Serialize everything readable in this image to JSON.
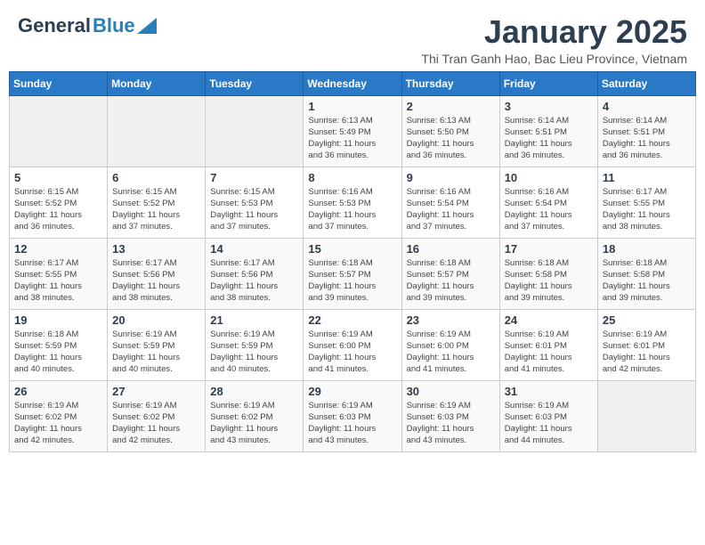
{
  "header": {
    "logo_general": "General",
    "logo_blue": "Blue",
    "calendar_title": "January 2025",
    "calendar_subtitle": "Thi Tran Ganh Hao, Bac Lieu Province, Vietnam"
  },
  "days_of_week": [
    "Sunday",
    "Monday",
    "Tuesday",
    "Wednesday",
    "Thursday",
    "Friday",
    "Saturday"
  ],
  "weeks": [
    [
      {
        "day": "",
        "info": ""
      },
      {
        "day": "",
        "info": ""
      },
      {
        "day": "",
        "info": ""
      },
      {
        "day": "1",
        "info": "Sunrise: 6:13 AM\nSunset: 5:49 PM\nDaylight: 11 hours\nand 36 minutes."
      },
      {
        "day": "2",
        "info": "Sunrise: 6:13 AM\nSunset: 5:50 PM\nDaylight: 11 hours\nand 36 minutes."
      },
      {
        "day": "3",
        "info": "Sunrise: 6:14 AM\nSunset: 5:51 PM\nDaylight: 11 hours\nand 36 minutes."
      },
      {
        "day": "4",
        "info": "Sunrise: 6:14 AM\nSunset: 5:51 PM\nDaylight: 11 hours\nand 36 minutes."
      }
    ],
    [
      {
        "day": "5",
        "info": "Sunrise: 6:15 AM\nSunset: 5:52 PM\nDaylight: 11 hours\nand 36 minutes."
      },
      {
        "day": "6",
        "info": "Sunrise: 6:15 AM\nSunset: 5:52 PM\nDaylight: 11 hours\nand 37 minutes."
      },
      {
        "day": "7",
        "info": "Sunrise: 6:15 AM\nSunset: 5:53 PM\nDaylight: 11 hours\nand 37 minutes."
      },
      {
        "day": "8",
        "info": "Sunrise: 6:16 AM\nSunset: 5:53 PM\nDaylight: 11 hours\nand 37 minutes."
      },
      {
        "day": "9",
        "info": "Sunrise: 6:16 AM\nSunset: 5:54 PM\nDaylight: 11 hours\nand 37 minutes."
      },
      {
        "day": "10",
        "info": "Sunrise: 6:16 AM\nSunset: 5:54 PM\nDaylight: 11 hours\nand 37 minutes."
      },
      {
        "day": "11",
        "info": "Sunrise: 6:17 AM\nSunset: 5:55 PM\nDaylight: 11 hours\nand 38 minutes."
      }
    ],
    [
      {
        "day": "12",
        "info": "Sunrise: 6:17 AM\nSunset: 5:55 PM\nDaylight: 11 hours\nand 38 minutes."
      },
      {
        "day": "13",
        "info": "Sunrise: 6:17 AM\nSunset: 5:56 PM\nDaylight: 11 hours\nand 38 minutes."
      },
      {
        "day": "14",
        "info": "Sunrise: 6:17 AM\nSunset: 5:56 PM\nDaylight: 11 hours\nand 38 minutes."
      },
      {
        "day": "15",
        "info": "Sunrise: 6:18 AM\nSunset: 5:57 PM\nDaylight: 11 hours\nand 39 minutes."
      },
      {
        "day": "16",
        "info": "Sunrise: 6:18 AM\nSunset: 5:57 PM\nDaylight: 11 hours\nand 39 minutes."
      },
      {
        "day": "17",
        "info": "Sunrise: 6:18 AM\nSunset: 5:58 PM\nDaylight: 11 hours\nand 39 minutes."
      },
      {
        "day": "18",
        "info": "Sunrise: 6:18 AM\nSunset: 5:58 PM\nDaylight: 11 hours\nand 39 minutes."
      }
    ],
    [
      {
        "day": "19",
        "info": "Sunrise: 6:18 AM\nSunset: 5:59 PM\nDaylight: 11 hours\nand 40 minutes."
      },
      {
        "day": "20",
        "info": "Sunrise: 6:19 AM\nSunset: 5:59 PM\nDaylight: 11 hours\nand 40 minutes."
      },
      {
        "day": "21",
        "info": "Sunrise: 6:19 AM\nSunset: 5:59 PM\nDaylight: 11 hours\nand 40 minutes."
      },
      {
        "day": "22",
        "info": "Sunrise: 6:19 AM\nSunset: 6:00 PM\nDaylight: 11 hours\nand 41 minutes."
      },
      {
        "day": "23",
        "info": "Sunrise: 6:19 AM\nSunset: 6:00 PM\nDaylight: 11 hours\nand 41 minutes."
      },
      {
        "day": "24",
        "info": "Sunrise: 6:19 AM\nSunset: 6:01 PM\nDaylight: 11 hours\nand 41 minutes."
      },
      {
        "day": "25",
        "info": "Sunrise: 6:19 AM\nSunset: 6:01 PM\nDaylight: 11 hours\nand 42 minutes."
      }
    ],
    [
      {
        "day": "26",
        "info": "Sunrise: 6:19 AM\nSunset: 6:02 PM\nDaylight: 11 hours\nand 42 minutes."
      },
      {
        "day": "27",
        "info": "Sunrise: 6:19 AM\nSunset: 6:02 PM\nDaylight: 11 hours\nand 42 minutes."
      },
      {
        "day": "28",
        "info": "Sunrise: 6:19 AM\nSunset: 6:02 PM\nDaylight: 11 hours\nand 43 minutes."
      },
      {
        "day": "29",
        "info": "Sunrise: 6:19 AM\nSunset: 6:03 PM\nDaylight: 11 hours\nand 43 minutes."
      },
      {
        "day": "30",
        "info": "Sunrise: 6:19 AM\nSunset: 6:03 PM\nDaylight: 11 hours\nand 43 minutes."
      },
      {
        "day": "31",
        "info": "Sunrise: 6:19 AM\nSunset: 6:03 PM\nDaylight: 11 hours\nand 44 minutes."
      },
      {
        "day": "",
        "info": ""
      }
    ]
  ]
}
